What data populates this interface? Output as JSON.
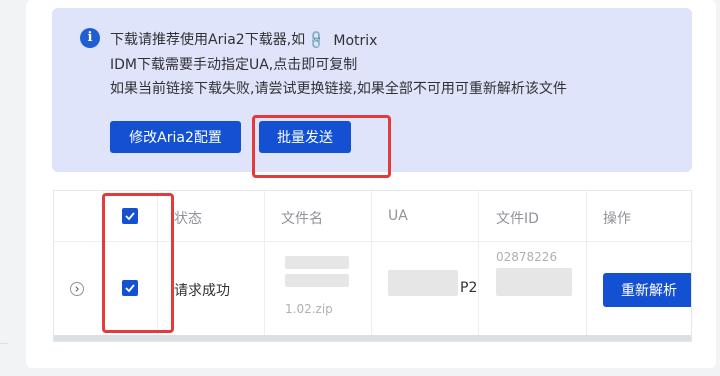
{
  "notice": {
    "line1": "下载请推荐使用Aria2下载器,如",
    "link_text": "Motrix",
    "line2": "IDM下载需要手动指定UA,点击即可复制",
    "line3": "如果当前链接下载失败,请尝试更换链接,如果全部不可用可重新解析该文件",
    "edit_button": "修改Aria2配置",
    "batch_button": "批量发送",
    "info_glyph": "i",
    "link_glyph": "🔗"
  },
  "table": {
    "headers": {
      "status": "状态",
      "filename": "文件名",
      "ua": "UA",
      "file_id": "文件ID",
      "actions": "操作"
    },
    "rows": [
      {
        "status": "请求成功",
        "filename_visible": "1.02.zip",
        "ua_visible": "P2",
        "file_id_visible": "02878226",
        "action": "重新解析",
        "checked": true
      }
    ]
  },
  "colors": {
    "primary": "#1450d2",
    "highlight": "#e33b3b",
    "notice_bg": "#dfe4fb"
  }
}
